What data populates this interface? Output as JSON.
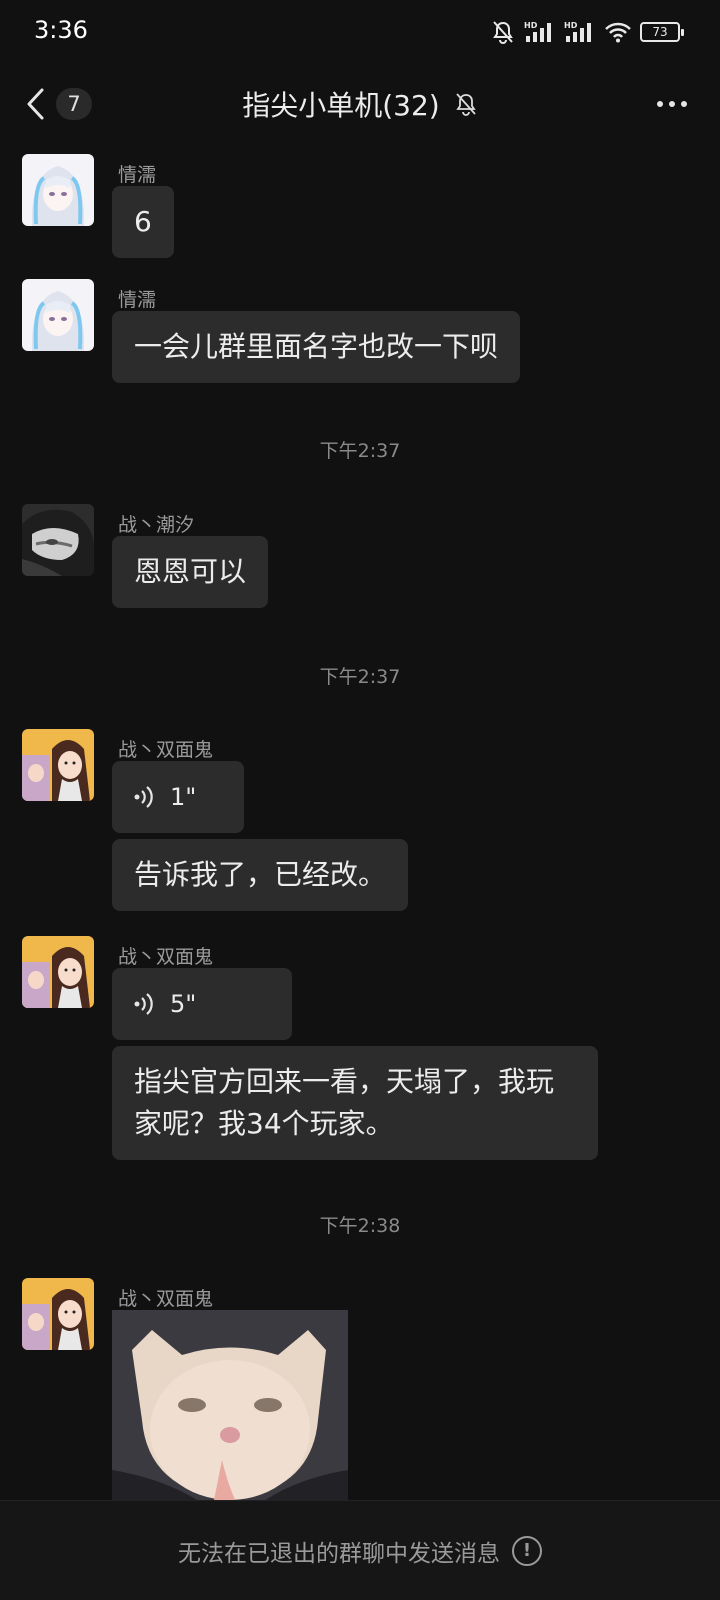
{
  "status_bar": {
    "time": "3:36",
    "battery": "73",
    "icons": [
      "mute-bell-icon",
      "hd-signal-icon",
      "hd-signal-icon",
      "wifi-icon",
      "battery-icon"
    ]
  },
  "nav": {
    "back_icon": "chevron-left-icon",
    "unread_count": "7",
    "title": "指尖小单机(32)",
    "mute_icon": "bell-off-icon",
    "more_icon": "more-dots-icon"
  },
  "messages": [
    {
      "sender": "情濡",
      "text": "6"
    },
    {
      "sender": "情濡",
      "text": "一会儿群里面名字也改一下呗"
    },
    {
      "timestamp": "下午2:37"
    },
    {
      "sender": "战丶潮汐",
      "text": "恩恩可以"
    },
    {
      "timestamp": "下午2:37"
    },
    {
      "sender": "战丶双面鬼",
      "voice_duration": "1\"",
      "transcript": "告诉我了，已经改。"
    },
    {
      "sender": "战丶双面鬼",
      "voice_duration": "5\"",
      "transcript": "指尖官方回来一看，天塌了，我玩家呢？我34个玩家。"
    },
    {
      "timestamp": "下午2:38"
    },
    {
      "sender": "战丶双面鬼",
      "image": "cat-sticker-image"
    }
  ],
  "bottom_bar": {
    "notice": "无法在已退出的群聊中发送消息",
    "icon": "info-circle-icon"
  },
  "colors": {
    "background": "#111111",
    "bubble": "#2c2c2c",
    "text": "#ececec",
    "muted": "#9a9a9a"
  }
}
